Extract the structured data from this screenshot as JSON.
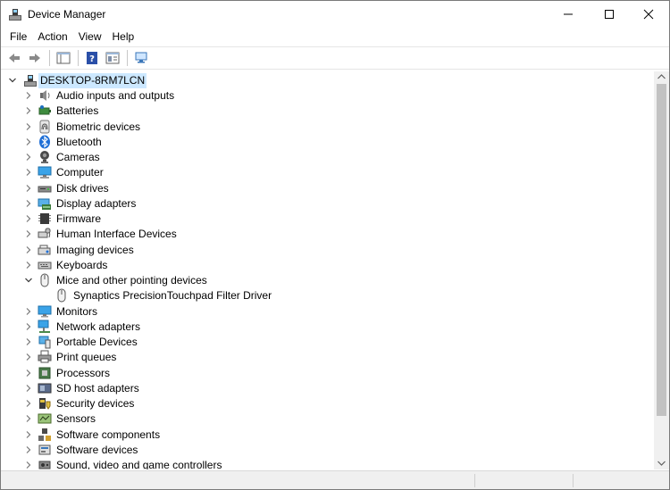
{
  "window": {
    "title": "Device Manager"
  },
  "menu": [
    "File",
    "Action",
    "View",
    "Help"
  ],
  "tree": {
    "root": "DESKTOP-8RM7LCN",
    "categories": [
      {
        "label": "Audio inputs and outputs",
        "icon": "speaker-icon"
      },
      {
        "label": "Batteries",
        "icon": "battery-icon"
      },
      {
        "label": "Biometric devices",
        "icon": "fingerprint-icon"
      },
      {
        "label": "Bluetooth",
        "icon": "bluetooth-icon"
      },
      {
        "label": "Cameras",
        "icon": "camera-icon"
      },
      {
        "label": "Computer",
        "icon": "computer-icon"
      },
      {
        "label": "Disk drives",
        "icon": "disk-drive-icon"
      },
      {
        "label": "Display adapters",
        "icon": "display-adapter-icon"
      },
      {
        "label": "Firmware",
        "icon": "firmware-icon"
      },
      {
        "label": "Human Interface Devices",
        "icon": "hid-icon"
      },
      {
        "label": "Imaging devices",
        "icon": "imaging-icon"
      },
      {
        "label": "Keyboards",
        "icon": "keyboard-icon"
      },
      {
        "label": "Mice and other pointing devices",
        "icon": "mouse-icon",
        "expanded": true,
        "children": [
          {
            "label": "Synaptics PrecisionTouchpad Filter Driver",
            "icon": "mouse-icon"
          }
        ]
      },
      {
        "label": "Monitors",
        "icon": "monitor-icon"
      },
      {
        "label": "Network adapters",
        "icon": "network-icon"
      },
      {
        "label": "Portable Devices",
        "icon": "portable-device-icon"
      },
      {
        "label": "Print queues",
        "icon": "printer-icon"
      },
      {
        "label": "Processors",
        "icon": "processor-icon"
      },
      {
        "label": "SD host adapters",
        "icon": "sd-card-icon"
      },
      {
        "label": "Security devices",
        "icon": "security-icon"
      },
      {
        "label": "Sensors",
        "icon": "sensor-icon"
      },
      {
        "label": "Software components",
        "icon": "software-component-icon"
      },
      {
        "label": "Software devices",
        "icon": "software-device-icon"
      },
      {
        "label": "Sound, video and game controllers",
        "icon": "sound-icon"
      }
    ]
  },
  "colors": {
    "selection": "#cce8ff",
    "accent": "#0078d7"
  }
}
